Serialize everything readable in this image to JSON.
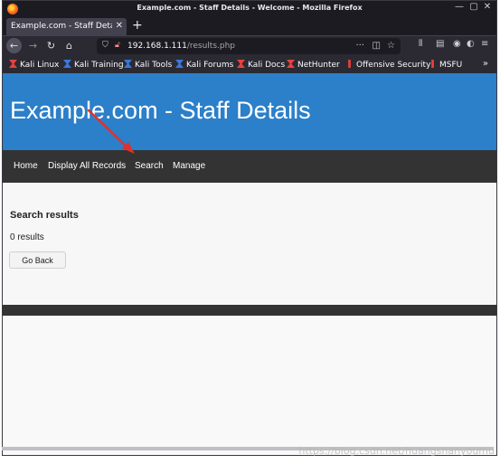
{
  "window": {
    "title": "Example.com - Staff Details - Welcome - Mozilla Firefox"
  },
  "tab": {
    "label": "Example.com - Staff Details"
  },
  "urlbar": {
    "host": "192.168.1.111",
    "path": "/results.php"
  },
  "bookmarks": [
    {
      "label": "Kali Linux",
      "icon": "kali-icon",
      "color": "#e8413c"
    },
    {
      "label": "Kali Training",
      "icon": "kali-icon",
      "color": "#3a78d8"
    },
    {
      "label": "Kali Tools",
      "icon": "kali-icon",
      "color": "#3a78d8"
    },
    {
      "label": "Kali Forums",
      "icon": "kali-icon",
      "color": "#3a78d8"
    },
    {
      "label": "Kali Docs",
      "icon": "kali-icon",
      "color": "#e8413c"
    },
    {
      "label": "NetHunter",
      "icon": "kali-icon",
      "color": "#e8413c"
    },
    {
      "label": "Offensive Security",
      "icon": "offsec-icon",
      "color": "#e8413c"
    },
    {
      "label": "MSFU",
      "icon": "offsec-icon",
      "color": "#e8413c"
    }
  ],
  "site": {
    "title": "Example.com - Staff Details",
    "nav": [
      "Home",
      "Display All Records",
      "Search",
      "Manage"
    ],
    "results_heading": "Search results",
    "results_count": "0 results",
    "go_back_label": "Go Back"
  },
  "watermark": "https://blog.csdn.net/huangshanyoumu",
  "colors": {
    "header_blue": "#2c7fc9",
    "nav_dark": "#333333",
    "annotation_arrow": "#e0312c"
  }
}
